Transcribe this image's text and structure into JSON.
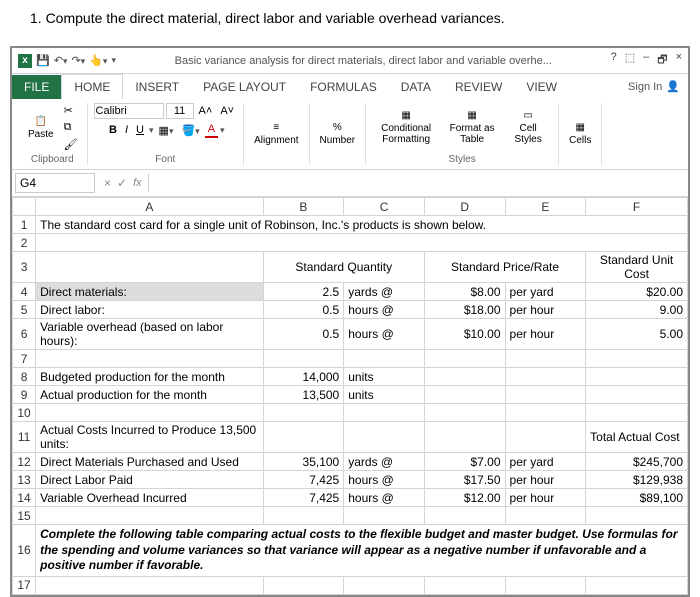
{
  "question": "1. Compute the direct material, direct labor and variable overhead variances.",
  "titlebar": {
    "filename": "Basic variance analysis for direct materials, direct labor and variable overhe...",
    "help": "?",
    "win": [
      "⬚",
      "–",
      "🗗",
      "×"
    ]
  },
  "tabs": {
    "file": "FILE",
    "home": "HOME",
    "insert": "INSERT",
    "pagelayout": "PAGE LAYOUT",
    "formulas": "FORMULAS",
    "data": "DATA",
    "review": "REVIEW",
    "view": "VIEW",
    "signin": "Sign In"
  },
  "ribbon": {
    "paste": "Paste",
    "clipboard": "Clipboard",
    "font": "Font",
    "fontname": "Calibri",
    "fontsize": "11",
    "alignment": "Alignment",
    "number": "Number",
    "percent": "%",
    "condfmt": "Conditional Formatting",
    "fmttable": "Format as Table",
    "cellstyles": "Cell Styles",
    "styles": "Styles",
    "cells": "Cells",
    "bold": "B",
    "italic": "I",
    "underline": "U",
    "grow": "A˄",
    "shrink": "A˅"
  },
  "namebox": "G4",
  "headers": [
    "",
    "A",
    "B",
    "C",
    "D",
    "E",
    "F"
  ],
  "rows": {
    "r1": {
      "A": "The standard cost card for a single unit of Robinson, Inc.'s products is shown below."
    },
    "r3": {
      "B": "Standard Quantity",
      "D": "Standard Price/Rate",
      "F": "Standard Unit Cost"
    },
    "r4": {
      "A": "Direct materials:",
      "B": "2.5",
      "C": "yards @",
      "D": "$8.00",
      "E": "per yard",
      "F": "$20.00"
    },
    "r5": {
      "A": "Direct labor:",
      "B": "0.5",
      "C": "hours @",
      "D": "$18.00",
      "E": "per hour",
      "F": "9.00"
    },
    "r6": {
      "A": "Variable overhead (based on labor hours):",
      "B": "0.5",
      "C": "hours @",
      "D": "$10.00",
      "E": "per hour",
      "F": "5.00"
    },
    "r8": {
      "A": "Budgeted production for the month",
      "B": "14,000",
      "C": "units"
    },
    "r9": {
      "A": "Actual production for the month",
      "B": "13,500",
      "C": "units"
    },
    "r11": {
      "A": "Actual Costs Incurred to Produce 13,500 units:",
      "F": "Total Actual Cost"
    },
    "r12": {
      "A": "Direct Materials Purchased and Used",
      "B": "35,100",
      "C": "yards @",
      "D": "$7.00",
      "E": "per yard",
      "F": "$245,700"
    },
    "r13": {
      "A": "Direct Labor Paid",
      "B": "7,425",
      "C": "hours @",
      "D": "$17.50",
      "E": "per hour",
      "F": "$129,938"
    },
    "r14": {
      "A": "Variable Overhead Incurred",
      "B": "7,425",
      "C": "hours @",
      "D": "$12.00",
      "E": "per hour",
      "F": "$89,100"
    },
    "r16": {
      "A": "Complete the following table comparing actual costs to the flexible budget and master budget.  Use formulas for the spending and volume variances so that variance will appear as a negative number if unfavorable and a positive number if favorable."
    }
  }
}
